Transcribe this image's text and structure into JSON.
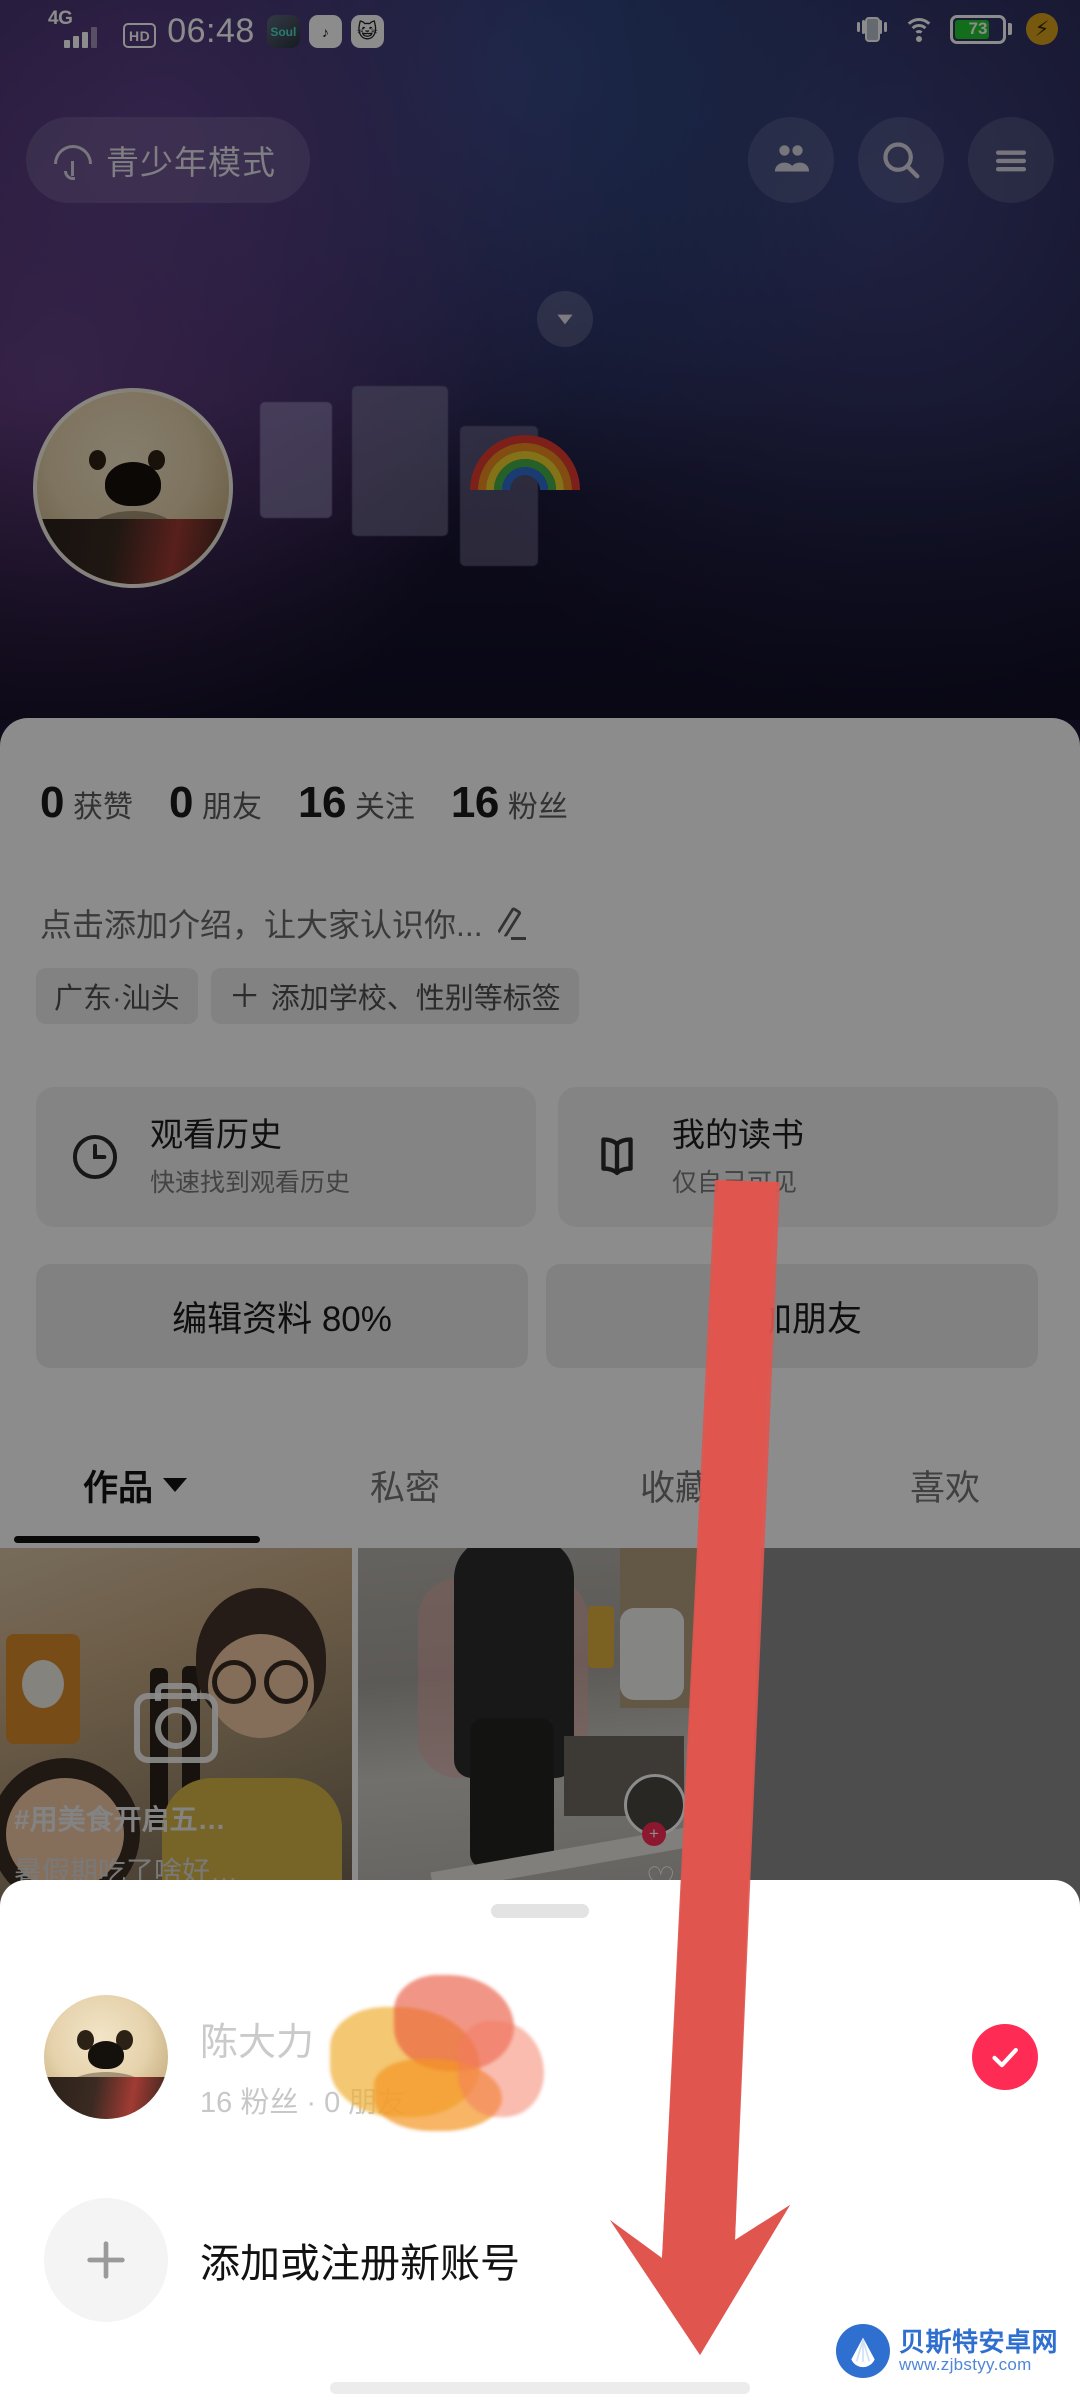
{
  "status_bar": {
    "network": "4G",
    "hd": "HD",
    "time": "06:48",
    "app_icons": [
      "Soul",
      "d",
      "cat-face"
    ],
    "battery_level": "73",
    "icons": [
      "signal-bars-icon",
      "hd-icon",
      "soul-app-icon",
      "douyin-app-icon",
      "cat-app-icon",
      "vibrate-icon",
      "wifi-icon",
      "battery-icon",
      "fast-charge-icon"
    ]
  },
  "top_nav": {
    "teen_mode_label": "青少年模式",
    "teen_mode_icon": "umbrella-icon",
    "friends_icon": "friends-icon",
    "search_icon": "search-icon",
    "menu_icon": "hamburger-menu-icon"
  },
  "profile": {
    "avatar_alt": "dog-avatar",
    "display_name": "陈大力",
    "name_obscured": true,
    "expand_icon": "chevron-down-icon",
    "stats": [
      {
        "num": "0",
        "label": "获赞"
      },
      {
        "num": "0",
        "label": "朋友"
      },
      {
        "num": "16",
        "label": "关注"
      },
      {
        "num": "16",
        "label": "粉丝"
      }
    ],
    "bio_placeholder": "点击添加介绍，让大家认识你...",
    "bio_edit_icon": "pencil-icon",
    "tags": [
      {
        "text": "广东·汕头",
        "plus": ""
      },
      {
        "text": "添加学校、性别等标签",
        "plus": "＋"
      }
    ]
  },
  "shortcut_cards": [
    {
      "icon": "clock-icon",
      "title": "观看历史",
      "subtitle": "快速找到观看历史"
    },
    {
      "icon": "book-icon",
      "title": "我的读书",
      "subtitle": "仅自己可见"
    },
    {
      "icon": "music-note-icon",
      "title": "",
      "subtitle": ""
    }
  ],
  "action_buttons": [
    {
      "label": "编辑资料 80%"
    },
    {
      "label": "添加朋友"
    }
  ],
  "tabs": [
    {
      "label": "作品",
      "active": true,
      "caret": true
    },
    {
      "label": "私密",
      "active": false,
      "caret": false
    },
    {
      "label": "收藏",
      "active": false,
      "caret": false
    },
    {
      "label": "喜欢",
      "active": false,
      "caret": false
    }
  ],
  "video_grid": [
    {
      "caption_1": "#用美食开启五…",
      "caption_2": "暑假期吃了啥好…"
    },
    {
      "caption_1": "",
      "caption_2": ""
    }
  ],
  "bottom_sheet": {
    "handle": "drag-handle",
    "account": {
      "name": "陈大力",
      "meta": "16 粉丝 · 0 朋友",
      "selected": true,
      "check_icon": "check-icon"
    },
    "add_account": {
      "label": "添加或注册新账号",
      "icon": "plus-icon"
    }
  },
  "annotation": {
    "arrow_color": "#e0564f",
    "points_to": "添加或注册新账号"
  },
  "watermark": {
    "site_name": "贝斯特安卓网",
    "url": "www.zjbstyy.com"
  },
  "colors": {
    "accent_red": "#FE2C55",
    "battery_green": "#22C932",
    "sheet_bg": "#FFFFFF"
  }
}
